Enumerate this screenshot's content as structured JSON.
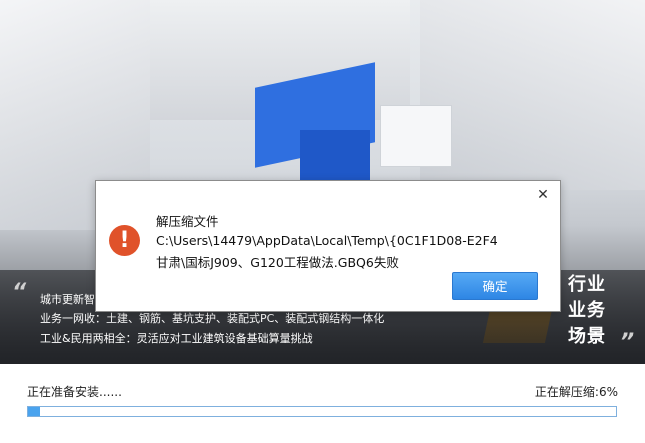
{
  "hero": {
    "lines": [
      "城市更新智",
      "业务一网收：土建、钢筋、基坑支护、装配式PC、装配式钢结构一体化",
      "工业&民用两相全：灵活应对工业建筑设备基础算量挑战"
    ],
    "tagline": [
      "行业",
      "业务",
      "场景"
    ],
    "quote_left": "“",
    "quote_right": "”"
  },
  "dialog": {
    "close_symbol": "✕",
    "icon_symbol": "!",
    "title": "解压缩文件",
    "path_line1": "C:\\Users\\14479\\AppData\\Local\\Temp\\{0C1F1D08-E2F4",
    "path_line2": "甘肃\\国标J909、G120工程做法.GBQ6失败",
    "ok_label": "确定"
  },
  "status": {
    "left": "正在准备安装......",
    "right": "正在解压缩:6%",
    "progress": 0.02
  },
  "colors": {
    "accent_blue": "#2e86e4",
    "error_orange": "#e0522a",
    "progress_fill": "#4aa3ee"
  }
}
